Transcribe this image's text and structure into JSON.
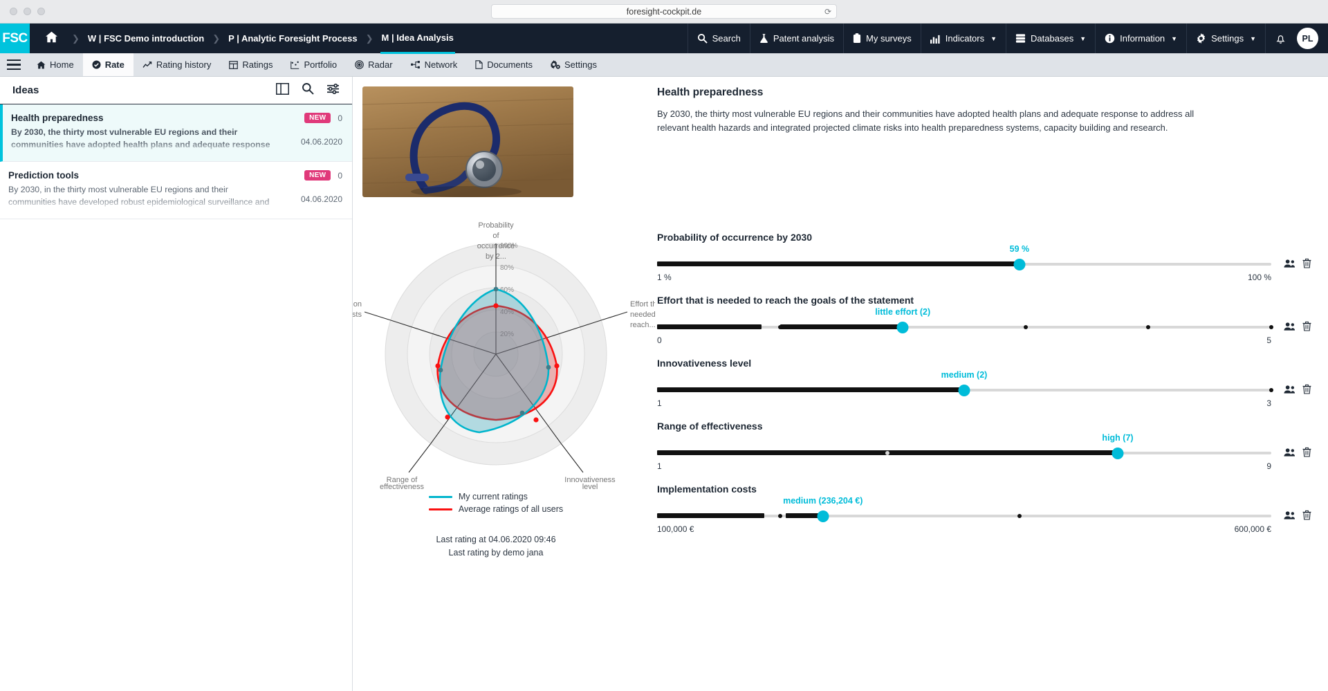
{
  "browser": {
    "url": "foresight-cockpit.de",
    "reload_icon": "reload-icon"
  },
  "topnav": {
    "brand": "FSC",
    "home_icon": "home-icon",
    "breadcrumbs": [
      {
        "prefix": "W |",
        "label": "FSC Demo introduction",
        "active": false
      },
      {
        "prefix": "P |",
        "label": "Analytic Foresight Process",
        "active": false
      },
      {
        "prefix": "M |",
        "label": "Idea Analysis",
        "active": true
      }
    ],
    "items": [
      {
        "label": "Search",
        "icon": "search-icon",
        "caret": false
      },
      {
        "label": "Patent analysis",
        "icon": "flask-icon",
        "caret": false
      },
      {
        "label": "My surveys",
        "icon": "clipboard-icon",
        "caret": false
      },
      {
        "label": "Indicators",
        "icon": "bar-chart-icon",
        "caret": true
      },
      {
        "label": "Databases",
        "icon": "database-icon",
        "caret": true
      },
      {
        "label": "Information",
        "icon": "info-icon",
        "caret": true
      },
      {
        "label": "Settings",
        "icon": "gear-icon",
        "caret": true
      }
    ],
    "bell_icon": "bell-icon",
    "avatar_initials": "PL"
  },
  "tabbar": {
    "menu_icon": "hamburger-icon",
    "tabs": [
      {
        "label": "Home",
        "icon": "home-icon",
        "active": false
      },
      {
        "label": "Rate",
        "icon": "check-circle-icon",
        "active": true
      },
      {
        "label": "Rating history",
        "icon": "line-chart-icon",
        "active": false
      },
      {
        "label": "Ratings",
        "icon": "table-icon",
        "active": false
      },
      {
        "label": "Portfolio",
        "icon": "scatter-icon",
        "active": false
      },
      {
        "label": "Radar",
        "icon": "radar-icon",
        "active": false
      },
      {
        "label": "Network",
        "icon": "network-icon",
        "active": false
      },
      {
        "label": "Documents",
        "icon": "document-icon",
        "active": false
      },
      {
        "label": "Settings",
        "icon": "gears-icon",
        "active": false
      }
    ]
  },
  "ideas": {
    "title": "Ideas",
    "tools": [
      {
        "name": "columns-icon"
      },
      {
        "name": "search-icon"
      },
      {
        "name": "filter-icon"
      }
    ],
    "items": [
      {
        "title": "Health preparedness",
        "description": "By 2030, the thirty most vulnerable EU regions and their communities have adopted health plans and adequate response to address all relevant health hazards and integrated projected cl",
        "badge": "NEW",
        "count": "0",
        "date": "04.06.2020",
        "selected": true
      },
      {
        "title": "Prediction tools",
        "description": "By 2030, in the thirty most vulnerable EU regions and their communities have developed robust epidemiological surveillance and modelling tools for assessing and predicting impact",
        "badge": "NEW",
        "count": "0",
        "date": "04.06.2020",
        "selected": false
      }
    ]
  },
  "detail": {
    "photo_alt": "stethoscope-photo",
    "title": "Health preparedness",
    "description": "By 2030, the thirty most vulnerable EU regions and their communities have adopted health plans and adequate response to address all relevant health hazards and integrated projected climate risks into health preparedness systems, capacity building and research.",
    "legend": [
      {
        "label": "My current ratings",
        "color": "#00b5cc"
      },
      {
        "label": "Average ratings of all users",
        "color": "#fa1010"
      }
    ],
    "last_rating_at": "Last rating at 04.06.2020 09:46",
    "last_rating_by": "Last rating by demo jana"
  },
  "chart_data": {
    "type": "radar",
    "title": "",
    "axes": [
      "Probability of occurrence by 2...",
      "Effort that is needed to reach...",
      "Innovativeness level",
      "Range of effectiveness",
      "Implementation costs"
    ],
    "tick_labels": [
      "20%",
      "40%",
      "60%",
      "80%",
      "100%"
    ],
    "rlim": [
      0,
      100
    ],
    "grid": true,
    "legend_position": "bottom",
    "series": [
      {
        "name": "My current ratings",
        "color": "#00b5cc",
        "values": [
          59,
          40,
          25,
          56,
          30
        ]
      },
      {
        "name": "Average ratings of all users",
        "color": "#fa1010",
        "values": [
          44,
          45,
          55,
          43,
          34
        ]
      }
    ]
  },
  "sliders": [
    {
      "label": "Probability of occurrence by 2030",
      "value_text": "59 %",
      "value_pct": 59,
      "min_label": "1 %",
      "max_label": "100 %",
      "ticks": [],
      "users_icon": "users-icon",
      "delete_icon": "trash-icon"
    },
    {
      "label": "Effort that is needed to reach the goals of the statement",
      "value_text": "little effort (2)",
      "value_pct": 40,
      "min_label": "0",
      "max_label": "5",
      "ticks": [
        20,
        60,
        80,
        100
      ],
      "users_icon": "users-icon",
      "delete_icon": "trash-icon"
    },
    {
      "label": "Innovativeness level",
      "value_text": "medium (2)",
      "value_pct": 50,
      "min_label": "1",
      "max_label": "3",
      "ticks": [
        100
      ],
      "users_icon": "users-icon",
      "delete_icon": "trash-icon"
    },
    {
      "label": "Range of effectiveness",
      "value_text": "high (7)",
      "value_pct": 75,
      "min_label": "1",
      "max_label": "9",
      "ticks": [
        37.5
      ],
      "users_icon": "users-icon",
      "delete_icon": "trash-icon"
    },
    {
      "label": "Implementation costs",
      "value_text": "medium (236,204 €)",
      "value_pct": 27,
      "min_label": "100,000 €",
      "max_label": "600,000 €",
      "ticks": [
        20,
        59
      ],
      "users_icon": "users-icon",
      "delete_icon": "trash-icon"
    }
  ]
}
